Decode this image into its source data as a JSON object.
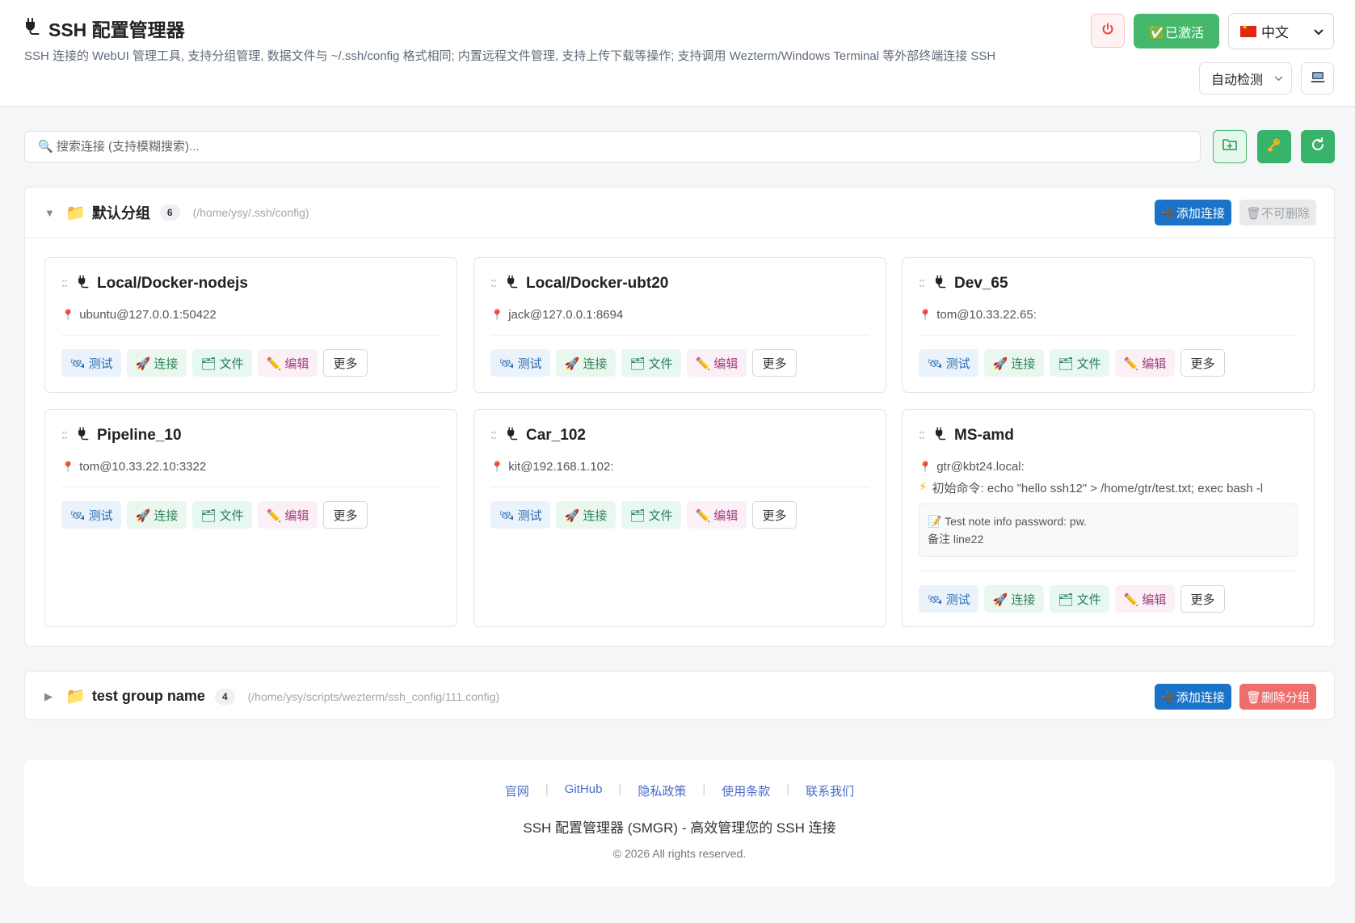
{
  "app": {
    "title": "SSH 配置管理器",
    "title_icon": "plug-icon",
    "subtitle": "SSH 连接的 WebUI 管理工具, 支持分组管理, 数据文件与 ~/.ssh/config 格式相同; 内置远程文件管理, 支持上传下载等操作; 支持调用 Wezterm/Windows Terminal 等外部终端连接 SSH"
  },
  "header": {
    "power_icon": "power-icon",
    "activated_label": "✅已激活",
    "language": "中文",
    "language_flag": "china-flag-icon",
    "terminal_mode": "自动检测",
    "terminal_icon": "laptop-icon"
  },
  "search": {
    "placeholder": "🔍 搜索连接 (支持模糊搜索)...",
    "value": ""
  },
  "toolbar": {
    "add_group_icon": "folder-add-icon",
    "key_icon": "key-icon",
    "refresh_icon": "refresh-icon"
  },
  "actions": {
    "test": "🛰 测试",
    "connect": "🚀 连接",
    "files": "🗂 文件",
    "edit": "✏️ 编辑",
    "more": "更多"
  },
  "groups": [
    {
      "name": "默认分组",
      "count": "6",
      "path": "(/home/ysy/.ssh/config)",
      "expanded": true,
      "add_label": "➕添加连接",
      "delete_label": "🗑不可删除",
      "connections": [
        {
          "name": "Local/Docker-nodejs",
          "host": "ubuntu@127.0.0.1:50422"
        },
        {
          "name": "Local/Docker-ubt20",
          "host": "jack@127.0.0.1:8694"
        },
        {
          "name": "Dev_65",
          "host": "tom@10.33.22.65:"
        },
        {
          "name": "Pipeline_10",
          "host": "tom@10.33.22.10:3322"
        },
        {
          "name": "Car_102",
          "host": "kit@192.168.1.102:"
        },
        {
          "name": "MS-amd",
          "host": "gtr@kbt24.local:",
          "init_cmd": "初始命令: echo \"hello ssh12\" > /home/gtr/test.txt; exec bash -l",
          "note_line1": "📝 Test note info password: pw.",
          "note_line2": "备注 line22"
        }
      ]
    },
    {
      "name": "test group name",
      "count": "4",
      "path": "(/home/ysy/scripts/wezterm/ssh_config/111.config)",
      "expanded": false,
      "add_label": "➕添加连接",
      "delete_label": "🗑删除分组"
    }
  ],
  "footer": {
    "links": [
      "官网",
      "GitHub",
      "隐私政策",
      "使用条款",
      "联系我们"
    ],
    "product": "SSH 配置管理器 (SMGR) - 高效管理您的 SSH 连接",
    "copyright": "© 2026 All rights reserved."
  },
  "colors": {
    "primary": "#1a73c9",
    "success": "#45b86b",
    "danger": "#ef6d6d",
    "background": "#f5f6f7"
  }
}
